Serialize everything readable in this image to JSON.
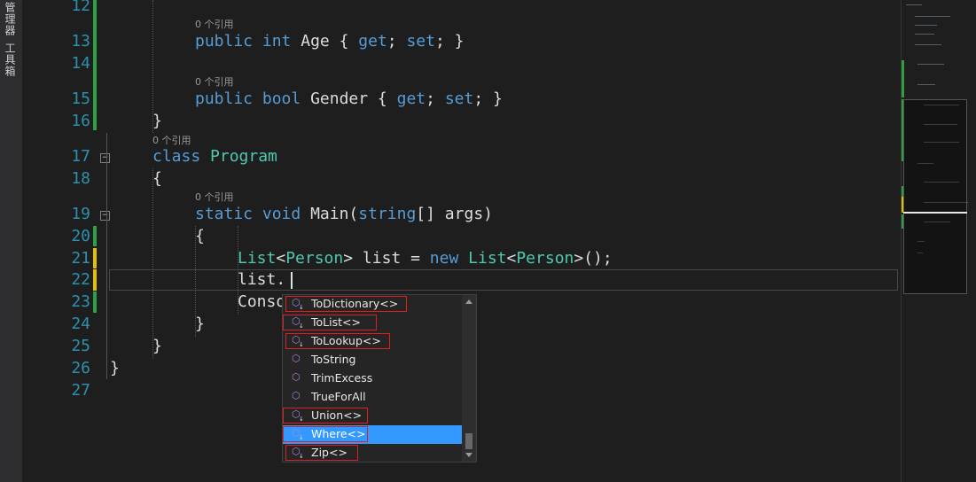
{
  "side_panel": {
    "tabs": [
      "管理器",
      "工具箱"
    ]
  },
  "editor": {
    "lines": [
      {
        "n": "12",
        "lens": "0 个引用",
        "tokens": []
      },
      {
        "n": "13",
        "tokens": [
          [
            "kw",
            "public"
          ],
          [
            "",
            ""
          ],
          [
            "kw",
            "int"
          ],
          [
            "",
            ""
          ],
          [
            "",
            "Age { "
          ],
          [
            "kw",
            "get"
          ],
          [
            "",
            "; "
          ],
          [
            "kw",
            "set"
          ],
          [
            "",
            "; }"
          ]
        ]
      },
      {
        "n": "14",
        "lens": "0 个引用",
        "tokens": []
      },
      {
        "n": "15",
        "tokens": [
          [
            "kw",
            "public"
          ],
          [
            "",
            ""
          ],
          [
            "kw",
            "bool"
          ],
          [
            "",
            ""
          ],
          [
            "",
            "Gender { "
          ],
          [
            "kw",
            "get"
          ],
          [
            "",
            "; "
          ],
          [
            "kw",
            "set"
          ],
          [
            "",
            "; }"
          ]
        ]
      },
      {
        "n": "16",
        "lens": "0 个引用",
        "tokens": [
          [
            "",
            "}"
          ]
        ]
      },
      {
        "n": "17",
        "tokens": [
          [
            "kw",
            "class"
          ],
          [
            "",
            ""
          ],
          [
            "ty",
            "Program"
          ]
        ]
      },
      {
        "n": "18",
        "lens": "0 个引用",
        "tokens": [
          [
            "",
            "{"
          ]
        ]
      },
      {
        "n": "19",
        "tokens": [
          [
            "kw",
            "static"
          ],
          [
            "",
            ""
          ],
          [
            "kw",
            "void"
          ],
          [
            "",
            ""
          ],
          [
            "",
            "Main("
          ],
          [
            "kw",
            "string"
          ],
          [
            "",
            "[] args)"
          ]
        ]
      },
      {
        "n": "20",
        "tokens": [
          [
            "",
            "{"
          ]
        ]
      },
      {
        "n": "21",
        "tokens": [
          [
            "ty",
            "List"
          ],
          [
            "",
            "<"
          ],
          [
            "ty",
            "Person"
          ],
          [
            "",
            "> list = "
          ],
          [
            "kw",
            "new"
          ],
          [
            "",
            ""
          ],
          [
            "ty",
            "List"
          ],
          [
            "",
            "<"
          ],
          [
            "ty",
            "Person"
          ],
          [
            "",
            ">();"
          ]
        ]
      },
      {
        "n": "22",
        "tokens": [
          [
            "",
            "list."
          ]
        ]
      },
      {
        "n": "23",
        "tokens": [
          [
            "",
            "Conso"
          ]
        ]
      },
      {
        "n": "24",
        "tokens": [
          [
            "",
            "}"
          ]
        ]
      },
      {
        "n": "25",
        "tokens": [
          [
            "",
            "}"
          ]
        ]
      },
      {
        "n": "26",
        "tokens": [
          [
            "",
            "}"
          ]
        ]
      },
      {
        "n": "27",
        "tokens": []
      }
    ]
  },
  "completion": {
    "items": [
      {
        "label": "ToDictionary<>",
        "icon": "extension-method-icon",
        "highlighted": true
      },
      {
        "label": "ToList<>",
        "icon": "extension-method-icon",
        "highlighted": true
      },
      {
        "label": "ToLookup<>",
        "icon": "extension-method-icon",
        "highlighted": true
      },
      {
        "label": "ToString",
        "icon": "method-icon",
        "highlighted": false
      },
      {
        "label": "TrimExcess",
        "icon": "method-icon",
        "highlighted": false
      },
      {
        "label": "TrueForAll",
        "icon": "method-icon",
        "highlighted": false
      },
      {
        "label": "Union<>",
        "icon": "extension-method-icon",
        "highlighted": true
      },
      {
        "label": "Where<>",
        "icon": "extension-method-icon",
        "highlighted": true,
        "selected": true
      },
      {
        "label": "Zip<>",
        "icon": "extension-method-icon",
        "highlighted": true
      }
    ]
  },
  "colors": {
    "keyword": "#569cd6",
    "type": "#4ec9b0",
    "line_number": "#2b91af",
    "saved_change": "#2ea043",
    "unsaved_change": "#e5c000",
    "selection": "#3399ff",
    "annotation": "#e02020"
  }
}
